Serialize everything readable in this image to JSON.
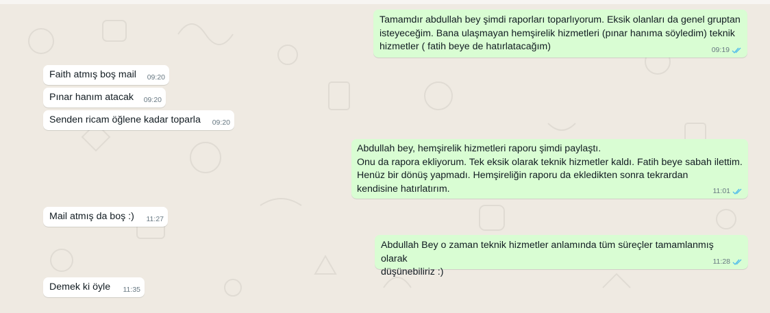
{
  "conversation": {
    "messages": [
      {
        "id": "m1",
        "direction": "out",
        "text": "Tamamdır abdullah bey şimdi raporları toparlıyorum. Eksik olanları da genel gruptan\nisteyeceğim. Bana ulaşmayan hemşirelik hizmetleri (pınar hanıma söyledim) teknik\nhizmetler ( fatih beye de hatırlatacağım)",
        "time": "09:19",
        "status": "read"
      },
      {
        "id": "m2",
        "direction": "in",
        "text": "Faith atmış boş mail",
        "time": "09:20"
      },
      {
        "id": "m3",
        "direction": "in",
        "text": "Pınar hanım atacak",
        "time": "09:20"
      },
      {
        "id": "m4",
        "direction": "in",
        "text": "Senden ricam öğlene kadar toparla",
        "time": "09:20"
      },
      {
        "id": "m5",
        "direction": "out",
        "text": "Abdullah bey, hemşirelik hizmetleri raporu şimdi paylaştı.\nOnu da rapora ekliyorum. Tek eksik olarak teknik hizmetler kaldı. Fatih beye sabah ilettim.\nHenüz bir dönüş yapmadı. Hemşireliğin raporu da ekledikten sonra tekrardan\nkendisine hatırlatırım.",
        "time": "11:01",
        "status": "read"
      },
      {
        "id": "m6",
        "direction": "in",
        "text": "Mail atmış da boş :)",
        "time": "11:27"
      },
      {
        "id": "m7",
        "direction": "out",
        "text": "Abdullah Bey o zaman teknik hizmetler anlamında tüm süreçler tamamlanmış olarak\ndüşünebiliriz :)",
        "time": "11:28",
        "status": "read"
      },
      {
        "id": "m8",
        "direction": "in",
        "text": "Demek ki öyle",
        "time": "11:35"
      }
    ]
  },
  "colors": {
    "background": "#efeae2",
    "incoming_bubble": "#ffffff",
    "outgoing_bubble": "#d9fdd3",
    "text": "#111b21",
    "meta_text": "#667781",
    "read_ticks": "#53bdeb"
  },
  "icons": {
    "read_receipt": "double-check-icon"
  }
}
